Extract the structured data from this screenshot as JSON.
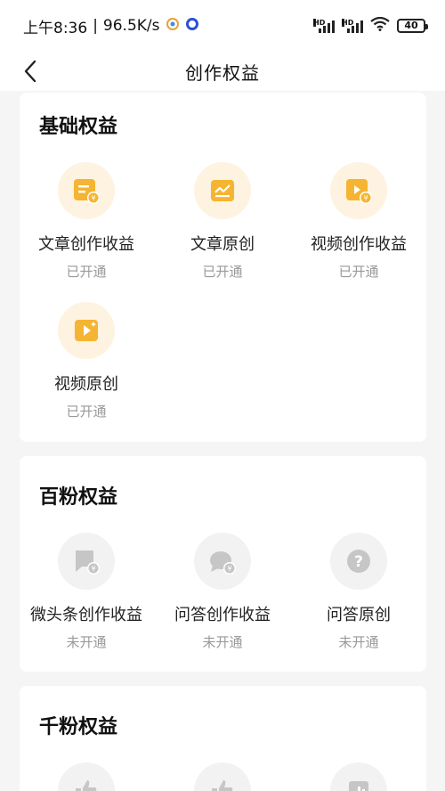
{
  "status_bar": {
    "time": "上午8:36",
    "speed": "96.5K/s",
    "battery": "40"
  },
  "header": {
    "title": "创作权益"
  },
  "sections": [
    {
      "title": "基础权益",
      "items": [
        {
          "label": "文章创作收益",
          "status": "已开通",
          "icon": "article-revenue-icon"
        },
        {
          "label": "文章原创",
          "status": "已开通",
          "icon": "article-original-icon"
        },
        {
          "label": "视频创作收益",
          "status": "已开通",
          "icon": "video-revenue-icon"
        },
        {
          "label": "视频原创",
          "status": "已开通",
          "icon": "video-original-icon"
        }
      ]
    },
    {
      "title": "百粉权益",
      "items": [
        {
          "label": "微头条创作收益",
          "status": "未开通",
          "icon": "micro-post-revenue-icon"
        },
        {
          "label": "问答创作收益",
          "status": "未开通",
          "icon": "qa-revenue-icon"
        },
        {
          "label": "问答原创",
          "status": "未开通",
          "icon": "qa-original-icon"
        }
      ]
    },
    {
      "title": "千粉权益",
      "items": [
        {
          "icon": "thumbs-up-icon"
        },
        {
          "icon": "thumbs-up-icon"
        },
        {
          "icon": "chart-icon"
        }
      ]
    }
  ],
  "colors": {
    "gold_bg": "#fdf3e0",
    "gold_icon": "#f5b431",
    "gray_bg": "#f2f2f2",
    "gray_icon": "#c6c6c6",
    "page_bg": "#f5f5f5"
  }
}
